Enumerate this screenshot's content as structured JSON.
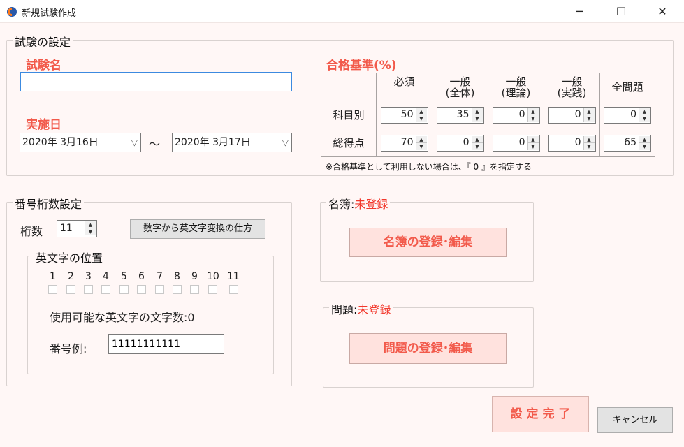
{
  "window": {
    "title": "新規試験作成",
    "minimize_glyph": "─",
    "maximize_glyph": "☐",
    "close_glyph": "✕"
  },
  "exam_settings": {
    "legend": "試験の設定",
    "exam_name_label": "試験名",
    "exam_name_value": "",
    "date_label": "実施日",
    "start_date": "2020年  3月16日",
    "end_date": "2020年  3月17日",
    "tilde": "～",
    "pass_criteria": {
      "title": "合格基準(%)",
      "columns": [
        "必須",
        "一般\n(全体)",
        "一般\n(理論)",
        "一般\n(実践)",
        "全問題"
      ],
      "rows": [
        {
          "label": "科目別",
          "values": [
            "50",
            "35",
            "0",
            "0",
            "0"
          ]
        },
        {
          "label": "総得点",
          "values": [
            "70",
            "0",
            "0",
            "0",
            "65"
          ]
        }
      ],
      "note": "※合格基準として利用しない場合は、『 0 』を指定する"
    }
  },
  "number_digits": {
    "legend": "番号桁数設定",
    "digits_label": "桁数",
    "digits_value": "11",
    "convert_button": "数字から英文字変換の仕方",
    "alpha_position": {
      "legend": "英文字の位置",
      "positions": [
        "1",
        "2",
        "3",
        "4",
        "5",
        "6",
        "7",
        "8",
        "9",
        "10",
        "11"
      ]
    },
    "usable_count_label": "使用可能な英文字の文字数:0",
    "example_label": "番号例:",
    "example_value": "11111111111"
  },
  "roster": {
    "legend_prefix": "名簿:",
    "status": "未登録",
    "button": "名簿の登録･編集"
  },
  "questions": {
    "legend_prefix": "問題:",
    "status": "未登録",
    "button": "問題の登録･編集"
  },
  "footer": {
    "complete_button": "設 定 完 了",
    "cancel_button": "キャンセル"
  },
  "colors": {
    "accent_red": "#f25a4b",
    "status_red": "#f2382c",
    "pink_button": "#ffe2de",
    "background": "#fff7f6"
  }
}
